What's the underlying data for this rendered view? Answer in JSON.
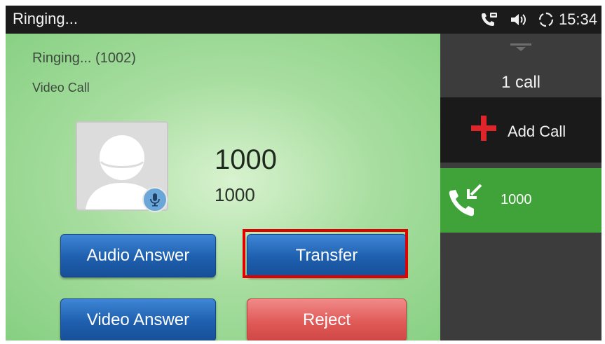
{
  "status_bar": {
    "title": "Ringing...",
    "time": "15:34",
    "icons": [
      "phone-voicemail-icon",
      "volume-icon",
      "sync-icon"
    ]
  },
  "call": {
    "ringing_status": "Ringing... (1002)",
    "call_type": "Video Call",
    "caller_name": "1000",
    "caller_number": "1000",
    "avatar_icon": "person-avatar-icon",
    "mic_icon": "microphone-icon"
  },
  "buttons": {
    "audio_answer": "Audio Answer",
    "transfer": "Transfer",
    "video_answer": "Video Answer",
    "reject": "Reject"
  },
  "side_panel": {
    "call_count": "1 call",
    "add_call": "Add Call",
    "calls": [
      {
        "label": "1000",
        "icon": "incoming-call-icon"
      }
    ]
  },
  "colors": {
    "accent_blue": "#1e5fae",
    "reject_red": "#e05a58",
    "active_call_green": "#3fa33a",
    "highlight_red": "#e00000",
    "add_call_plus": "#e0252a"
  }
}
